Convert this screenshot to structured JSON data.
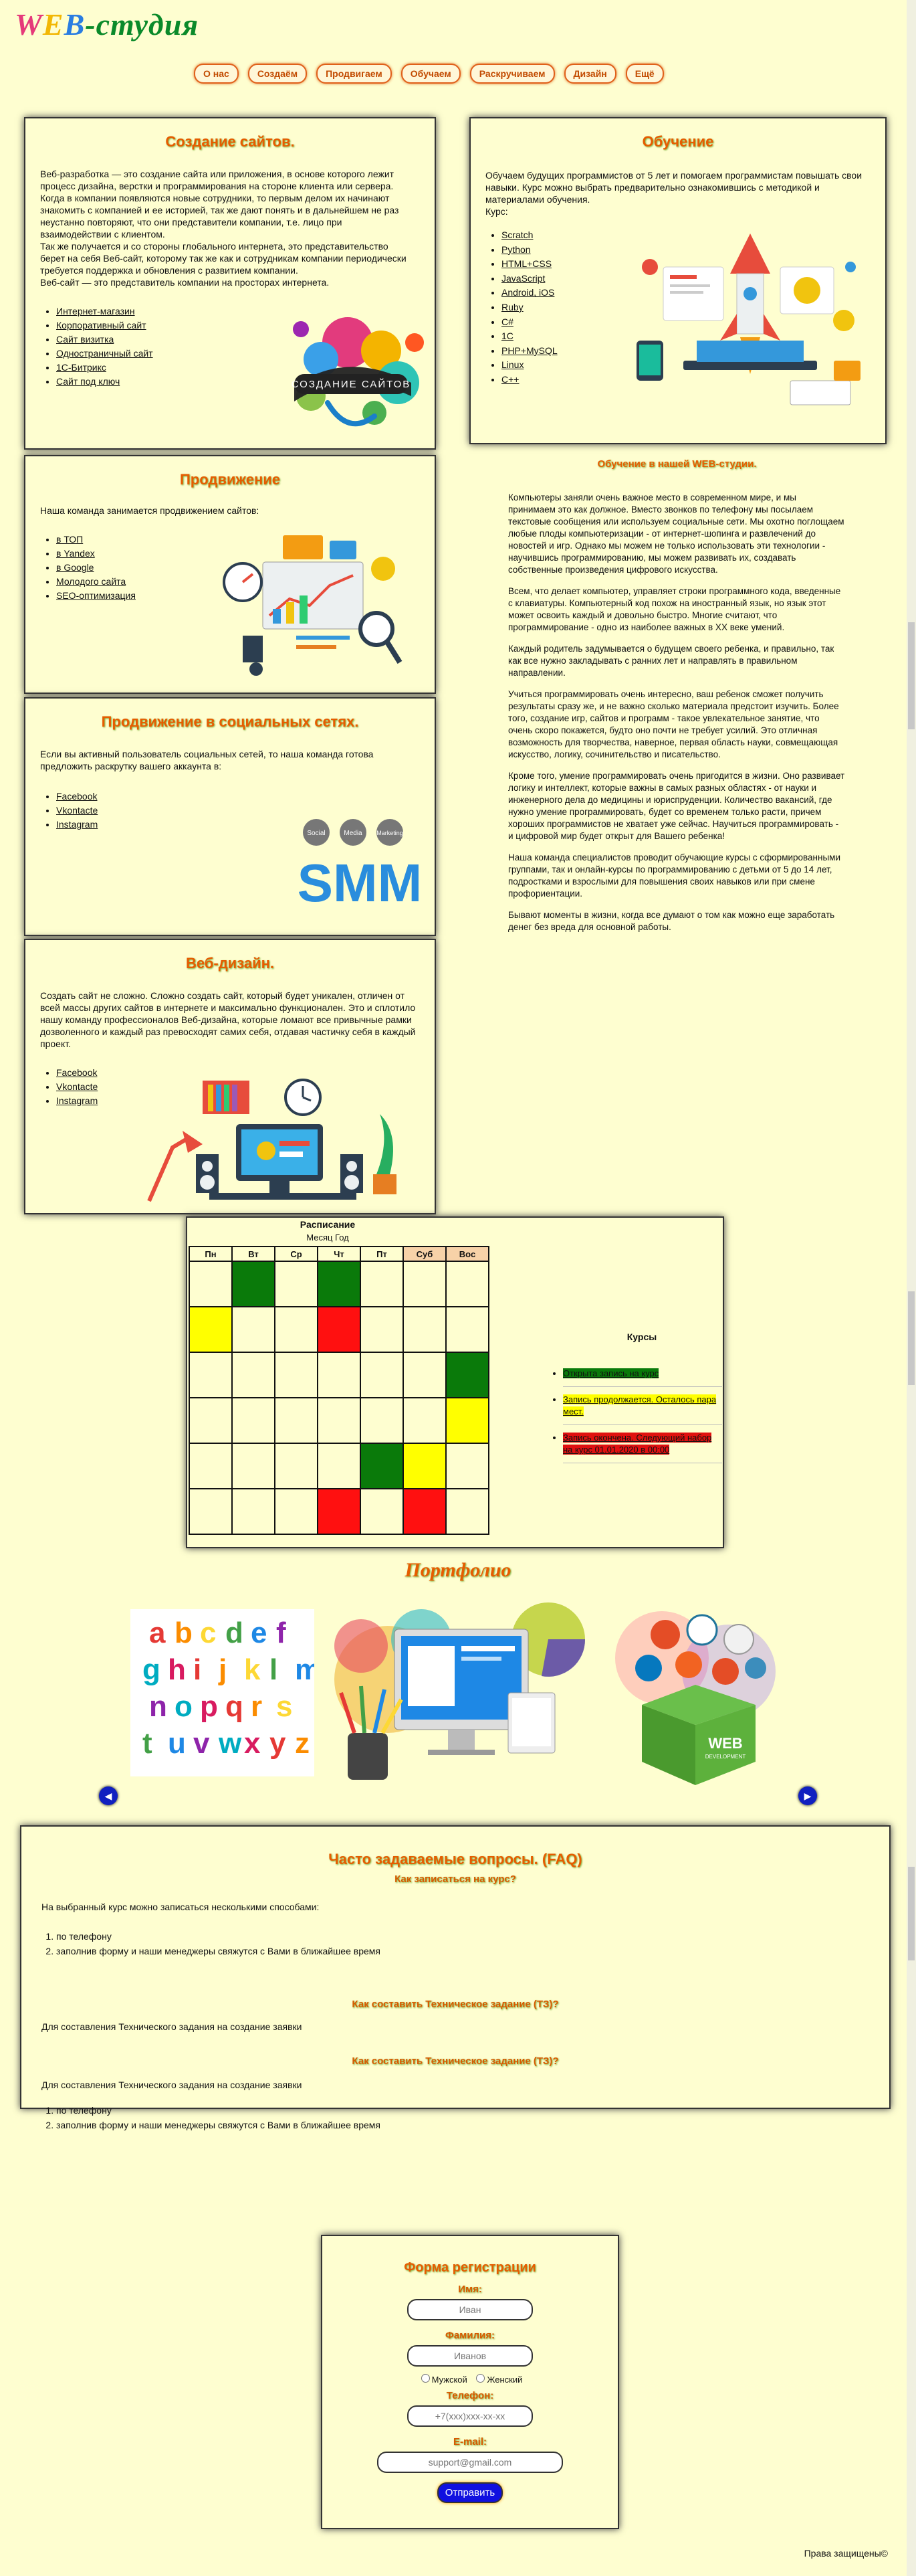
{
  "logo": {
    "w": "W",
    "e": "E",
    "b": "B",
    "rest": "-студия"
  },
  "nav": [
    "О нас",
    "Создаём",
    "Продвигаем",
    "Обучаем",
    "Раскручиваем",
    "Дизайн",
    "Ещё"
  ],
  "create": {
    "title": "Создание сайтов.",
    "text": [
      "Веб-разработка — это создание сайта или приложения, в основе которого лежит процесс дизайна, верстки и программирования на стороне клиента или сервера.",
      "Когда в компании появляются новые сотрудники, то первым делом их начинают знакомить с компанией и ее историей, так же дают понять и в дальнейшем не раз неустанно повторяют, что они представители компании, т.е. лицо при взаимодействии с клиентом.",
      "Так же получается и со стороны глобального интернета, это представительство берет на себя Веб-сайт, которому так же как и сотрудникам компании периодически требуется поддержка и обновления с развитием компании.",
      "Веб-сайт — это представитель компании на просторах интернета."
    ],
    "items": [
      "Интернет-магазин",
      "Корпоративный сайт",
      "Сайт визитка",
      "Одностраничный сайт",
      "1С-Битрикс",
      "Сайт под ключ"
    ],
    "badge": "СОЗДАНИЕ САЙТОВ"
  },
  "learn": {
    "title": "Обучение",
    "text": "Обучаем будущих программистов от 5 лет и помогаем программистам повышать свои навыки. Курс можно выбрать предварительно ознакомившись с методикой и материалами обучения.",
    "kurs": "Курс:",
    "items": [
      "Scratch",
      "Python",
      "HTML+CSS",
      "JavaScript",
      "Android, iOS",
      "Ruby",
      "C#",
      "1С",
      "PHP+MySQL",
      "Linux",
      "C++"
    ]
  },
  "promo": {
    "title": "Продвижение",
    "text": "Наша команда занимается продвижением сайтов:",
    "items": [
      "в ТОП",
      "в Yandex",
      "в Google",
      "Молодого сайта",
      "SEO-оптимизация"
    ]
  },
  "social": {
    "title": "Продвижение в социальных сетях.",
    "text": "Если вы активный пользователь социальных сетей, то наша команда готова предложить раскрутку вашего аккаунта в:",
    "items": [
      "Facebook",
      "Vkontacte",
      "Instagram"
    ],
    "bubbles": [
      "Social",
      "Media",
      "Marketing"
    ],
    "smm": "SMM"
  },
  "design": {
    "title": "Веб-дизайн.",
    "text": "Создать сайт не сложно. Сложно создать сайт, который будет уникален, отличен от всей массы других сайтов в интернете и максимально функционален. Это и сплотило нашу команду профессионалов Веб-дизайна, которые ломают все привычные рамки дозволенного и каждый раз превосходят самих себя, отдавая частичку себя в каждый проект.",
    "items": [
      "Facebook",
      "Vkontacte",
      "Instagram"
    ]
  },
  "article": {
    "title": "Обучение в нашей WEB-студии.",
    "paragraphs": [
      "Компьютеры заняли очень важное место в современном мире, и мы принимаем это как должное. Вместо звонков по телефону мы посылаем текстовые сообщения или используем социальные сети. Мы охотно поглощаем любые плоды компьютеризации - от интернет-шопинга и развлечений до новостей и игр. Однако мы можем не только использовать эти технологии - научившись программированию, мы можем развивать их, создавать собственные произведения цифрового искусства.",
      "Всем, что делает компьютер, управляет строки программного кода, введенные с клавиатуры. Компьютерный код похож на иностранный язык, но язык этот может освоить каждый и довольно быстро. Многие считают, что программирование - одно из наиболее важных в XX веке умений.",
      "Каждый родитель задумывается о будущем своего ребенка, и правильно, так как все нужно закладывать с ранних лет и направлять в правильном направлении.",
      "Учиться программировать очень интересно, ваш ребенок сможет получить результаты сразу же, и не важно сколько материала предстоит изучить. Более того, создание игр, сайтов и программ - такое увлекательное занятие, что очень скоро покажется, будто оно почти не требует усилий. Это отличная возможность для творчества, наверное, первая область науки, совмещающая искусство, логику, сочинительство и писательство.",
      "Кроме того, умение программировать очень пригодится в жизни. Оно развивает логику и интеллект, которые важны в самых разных областях - от науки и инженерного дела до медицины и юриспруденции. Количество вакансий, где нужно умение программировать, будет со временем только расти, причем хороших программистов не хватает уже сейчас. Научиться программировать - и цифровой мир будет открыт для Вашего ребенка!",
      "Наша команда специалистов проводит обучающие курсы с сформированными группами, так и онлайн-курсы по программированию с детьми от 5 до 14 лет, подростками и взрослыми для повышения своих навыков или при смене профориентации.",
      "Бывают моменты в жизни, когда все думают о том как можно еще заработать денег без вреда для основной работы."
    ]
  },
  "schedule": {
    "title": "Расписание",
    "subtitle": "Месяц Год",
    "days": [
      "Пн",
      "Вт",
      "Ср",
      "Чт",
      "Пт",
      "Суб",
      "Вос"
    ],
    "colors": {
      "green": "#0a7a0a",
      "yellow": "#ffff00",
      "red": "#ff1010",
      "weekend": "#f7d2a8"
    },
    "grid": [
      [
        "",
        "green",
        "",
        "green",
        "",
        "",
        ""
      ],
      [
        "yellow",
        "",
        "",
        "red",
        "",
        "",
        ""
      ],
      [
        "",
        "",
        "",
        "",
        "",
        "",
        "green"
      ],
      [
        "",
        "",
        "",
        "",
        "",
        "",
        "yellow"
      ],
      [
        "",
        "",
        "",
        "",
        "green",
        "yellow",
        ""
      ],
      [
        "",
        "",
        "",
        "red",
        "",
        "red",
        ""
      ]
    ]
  },
  "courses": {
    "title": "Курсы",
    "items": [
      "Открыта запись на курс",
      "Запись продолжается. Осталось пара мест.",
      "Запись окончена. Следующий набор на курс 01.01.2020 в 00:00"
    ]
  },
  "portfolio": {
    "title": "Портфолио",
    "img1": "abcdefghijklmnopqrstuvwxyz",
    "web": "WEB",
    "web_sub": "DEVELOPMENT"
  },
  "faq": {
    "title": "Часто задаваемые вопросы. (FAQ)",
    "q1": "Как записаться на курс?",
    "a1": "На выбранный курс можно записаться несколькими способами:",
    "a1_items": [
      "по телефону",
      "заполнив форму и наши менеджеры свяжутся с Вами в ближайшее время"
    ],
    "q2": "Как составить Техническое задание (ТЗ)?",
    "a2": "Для составления Технического задания на создание заявки",
    "q3": "Как составить Техническое задание (ТЗ)?",
    "a3": "Для составления Технического задания на создание заявки",
    "a3_items": [
      "по телефону",
      "заполнив форму и наши менеджеры свяжутся с Вами в ближайшее время"
    ]
  },
  "form": {
    "title": "Форма регистрации",
    "name_label": "Имя:",
    "name_ph": "Иван",
    "surname_label": "Фамилия:",
    "surname_ph": "Иванов",
    "male": "Мужской",
    "female": "Женский",
    "phone_label": "Телефон:",
    "phone_ph": "+7(xxx)xxx-xx-xx",
    "email_label": "E-mail:",
    "email_ph": "support@gmail.com",
    "submit": "Отправить"
  },
  "footer": "Права защищены©"
}
